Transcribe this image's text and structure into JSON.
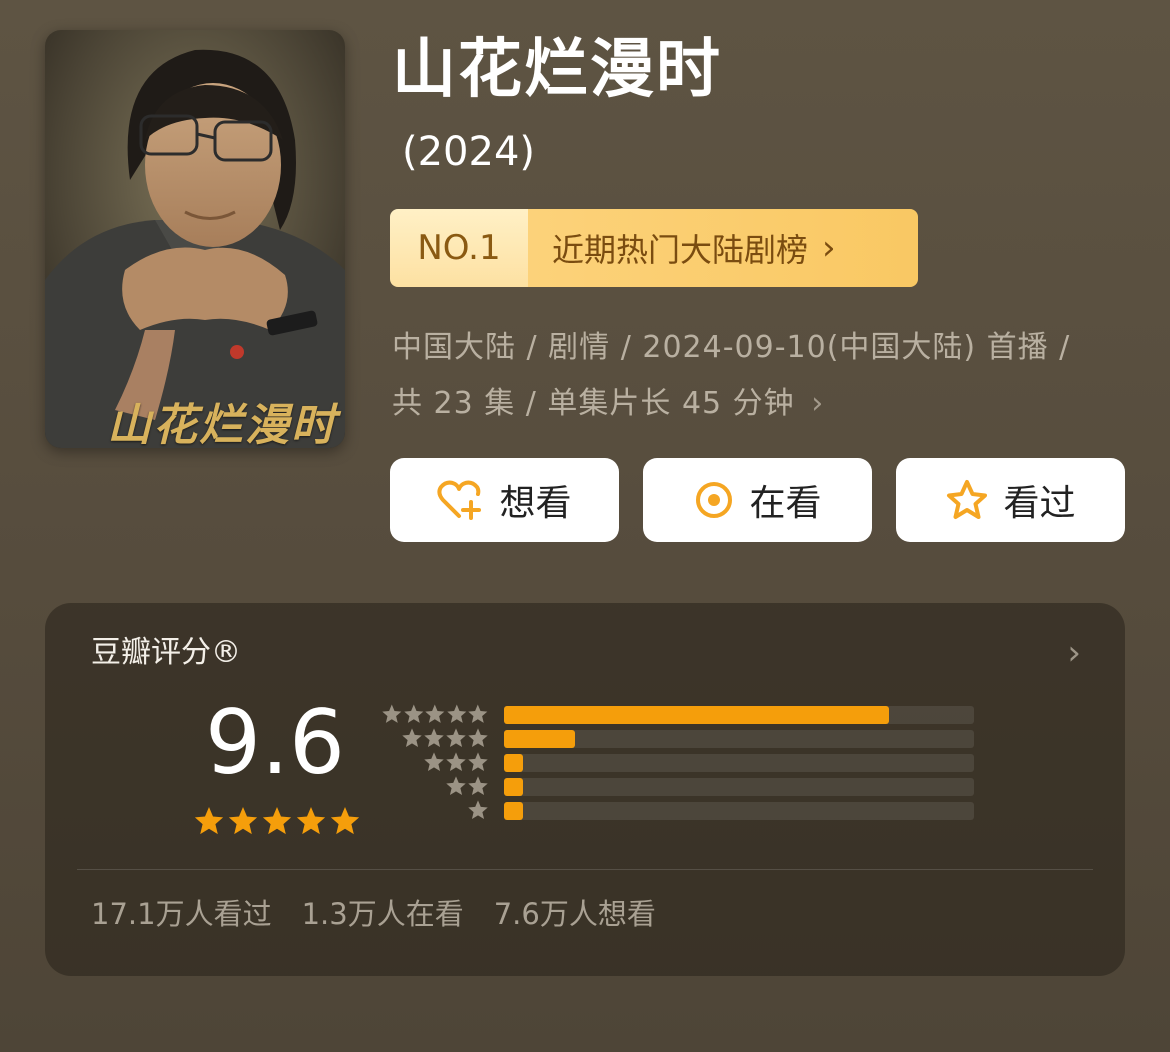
{
  "show": {
    "title": "山花烂漫时",
    "year": "(2024)",
    "poster_title": "山花烂漫时"
  },
  "ranking": {
    "number": "NO.1",
    "label": "近期热门大陆剧榜",
    "chevron": "›"
  },
  "meta": {
    "line1": "中国大陆 / 剧情 / 2024-09-10(中国大陆) 首播 /",
    "line2": "共 23 集 / 单集片长 45 分钟",
    "chevron": "›"
  },
  "actions": {
    "want": {
      "label": "想看",
      "icon": "heart-plus-icon"
    },
    "watching": {
      "label": "在看",
      "icon": "target-circle-icon"
    },
    "watched": {
      "label": "看过",
      "icon": "star-outline-icon"
    }
  },
  "rating": {
    "title": "豆瓣评分®",
    "score": "9.6",
    "stars": 5,
    "chevron": "›",
    "distribution": [
      {
        "stars": 5,
        "percent": 82
      },
      {
        "stars": 4,
        "percent": 15
      },
      {
        "stars": 3,
        "percent": 4
      },
      {
        "stars": 2,
        "percent": 4
      },
      {
        "stars": 1,
        "percent": 4
      }
    ],
    "stats": [
      "17.1万人看过",
      "1.3万人在看",
      "7.6万人想看"
    ]
  },
  "colors": {
    "background": "#594f40",
    "accent": "#f59e0b",
    "badge_text": "#7a4c10",
    "meta_text": "#b9b0a1"
  }
}
